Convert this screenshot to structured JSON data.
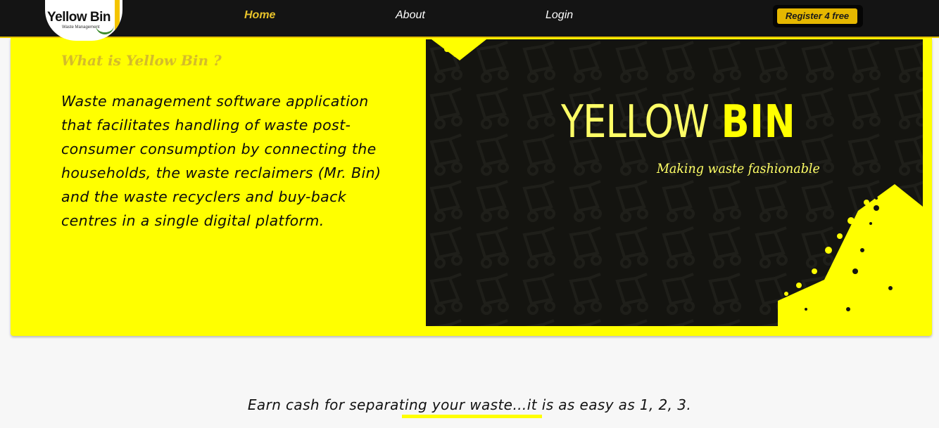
{
  "brand": {
    "name": "Yellow Bin",
    "subtitle": "Waste Management",
    "accent": "#ffff00"
  },
  "nav": {
    "links": [
      {
        "label": "Home",
        "active": true
      },
      {
        "label": "About",
        "active": false
      },
      {
        "label": "Login",
        "active": false
      }
    ],
    "register_label": "Register 4 free"
  },
  "hero": {
    "heading": "What is Yellow Bin ?",
    "body": "Waste management software application that facilitates handling of waste post-consumer consumption by connecting the households, the waste reclaimers (Mr. Bin) and the waste recyclers and buy-back centres in a single digital platform.",
    "banner": {
      "title_light": "YELLOW",
      "title_bold": "BIN",
      "tagline": "Making waste fashionable",
      "background": "#141410",
      "pattern_icon": "bin-cart-icon"
    }
  },
  "section": {
    "tagline": "Earn cash for separating your waste…it is as easy as 1, 2, 3."
  }
}
